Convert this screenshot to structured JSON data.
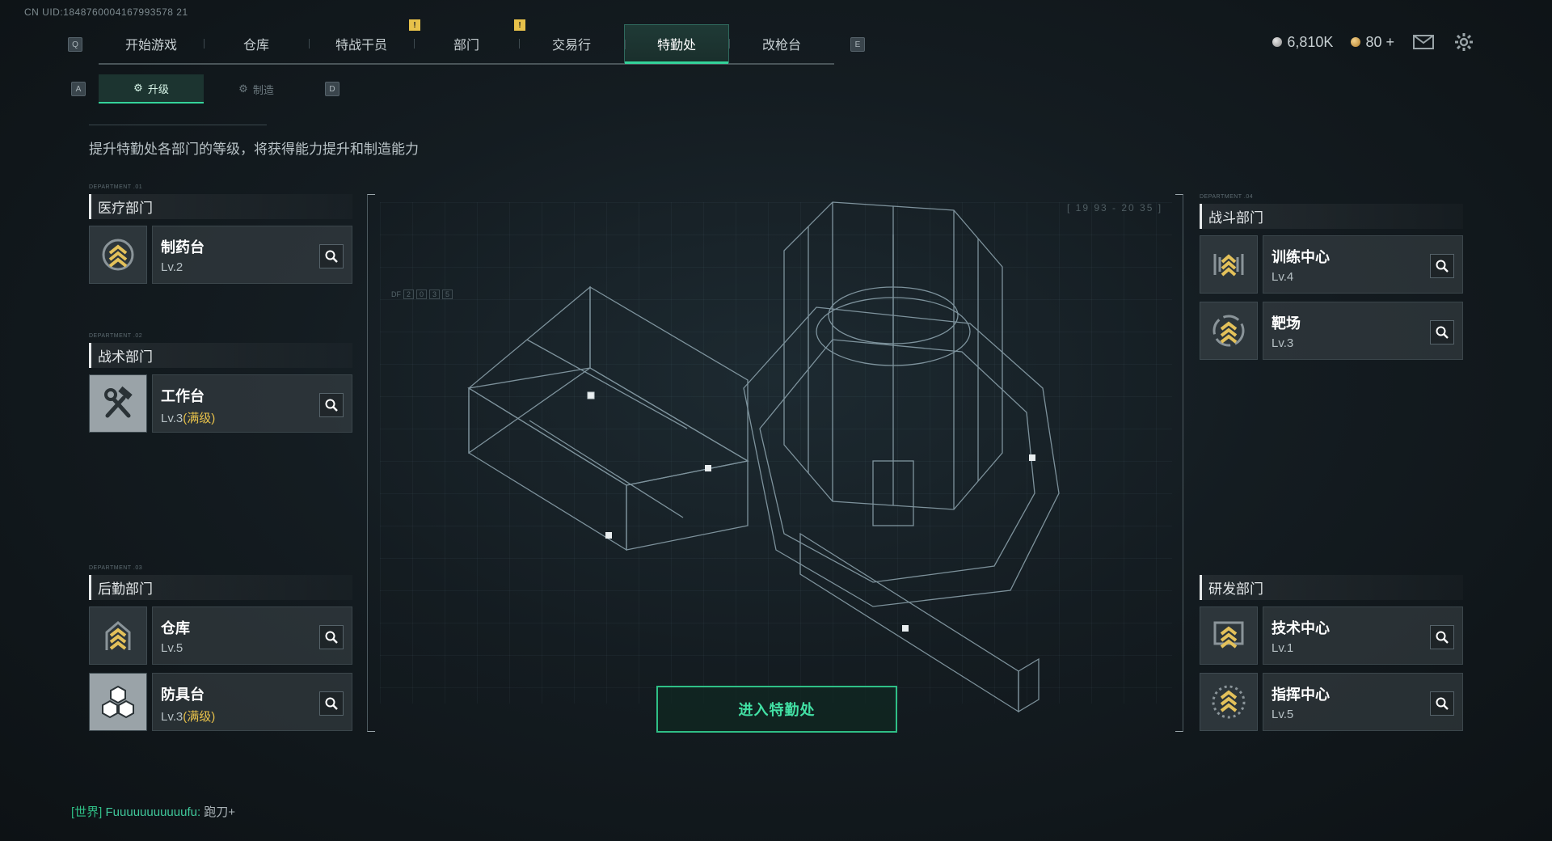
{
  "uid": "CN UID:1848760004167993578 21",
  "nav": {
    "left_key": "Q",
    "right_key": "E",
    "tabs": [
      {
        "label": "开始游戏"
      },
      {
        "label": "仓库"
      },
      {
        "label": "特战干员"
      },
      {
        "label": "部门"
      },
      {
        "label": "交易行"
      },
      {
        "label": "特勤处"
      },
      {
        "label": "改枪台"
      }
    ],
    "active_tab": "特勤处",
    "badge_text": "!"
  },
  "currency": {
    "silver": "6,810K",
    "gold": "80 +"
  },
  "subnav": {
    "left_key": "A",
    "right_key": "D",
    "tabs": [
      {
        "label": "升级"
      },
      {
        "label": "制造"
      }
    ],
    "active": "升级"
  },
  "description": "提升特勤处各部门的等级，将获得能力提升和制造能力",
  "departments": {
    "medical": {
      "tag": "DEPARTMENT .01",
      "title": "医疗部门",
      "facilities": [
        {
          "name": "制药台",
          "level": "Lv.2",
          "max": ""
        }
      ]
    },
    "tactical": {
      "tag": "DEPARTMENT .02",
      "title": "战术部门",
      "facilities": [
        {
          "name": "工作台",
          "level": "Lv.3",
          "max": "(满级)"
        }
      ]
    },
    "logistics": {
      "tag": "DEPARTMENT .03",
      "title": "后勤部门",
      "facilities": [
        {
          "name": "仓库",
          "level": "Lv.5",
          "max": ""
        },
        {
          "name": "防具台",
          "level": "Lv.3",
          "max": "(满级)"
        }
      ]
    },
    "combat": {
      "tag": "DEPARTMENT .04",
      "title": "战斗部门",
      "facilities": [
        {
          "name": "训练中心",
          "level": "Lv.4",
          "max": ""
        },
        {
          "name": "靶场",
          "level": "Lv.3",
          "max": ""
        }
      ]
    },
    "research": {
      "tag": "",
      "title": "研发部门",
      "facilities": [
        {
          "name": "技术中心",
          "level": "Lv.1",
          "max": ""
        },
        {
          "name": "指挥中心",
          "level": "Lv.5",
          "max": ""
        }
      ]
    }
  },
  "enter_button": "进入特勤处",
  "chat": {
    "channel": "[世界]",
    "user": "Fuuuuuuuuuuufu:",
    "message": "跑刀+"
  },
  "hud": {
    "coords": "[ 19 93 - 20 35 ]",
    "df_label": "DF"
  },
  "colors": {
    "accent": "#34d39a",
    "max_level": "#e7c14a",
    "badge": "#e7c14a"
  }
}
